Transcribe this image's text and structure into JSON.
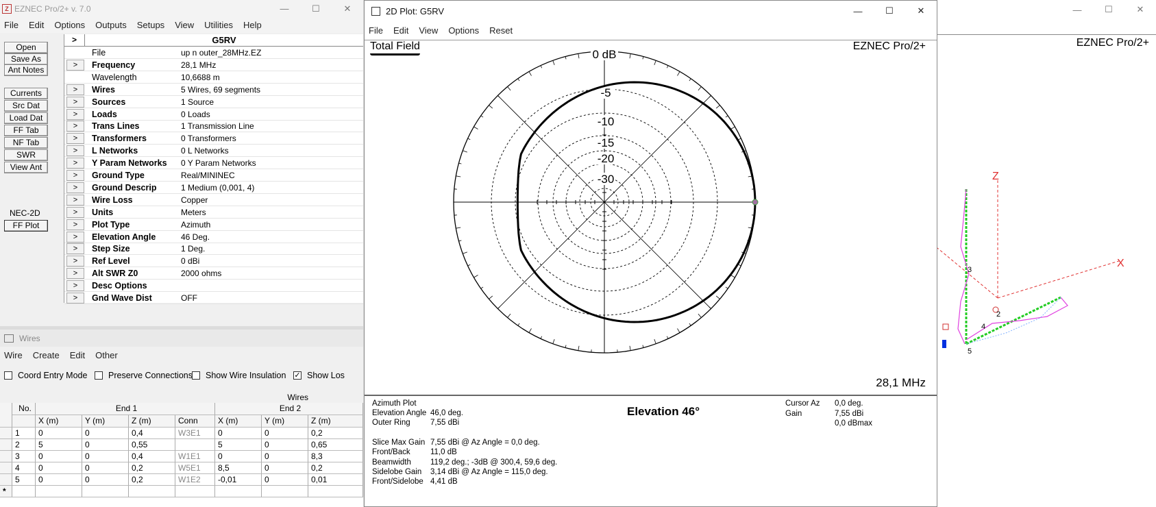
{
  "main": {
    "title": "EZNEC Pro/2+  v. 7.0",
    "menu": [
      "File",
      "Edit",
      "Options",
      "Outputs",
      "Setups",
      "View",
      "Utilities",
      "Help"
    ],
    "buttons_top": [
      "Open",
      "Save As",
      "Ant Notes"
    ],
    "buttons_mid": [
      "Currents",
      "Src Dat",
      "Load Dat",
      "FF Tab",
      "NF Tab",
      "SWR",
      "View Ant"
    ],
    "engine": "NEC-2D",
    "ffplot": "FF Plot",
    "model_name": "G5RV",
    "header_arrow": ">",
    "rows": [
      {
        "label": "File",
        "value": "up n outer_28MHz.EZ",
        "arrow": false,
        "bold": false
      },
      {
        "label": "Frequency",
        "value": "28,1 MHz",
        "arrow": true,
        "bold": true
      },
      {
        "label": "Wavelength",
        "value": "10,6688 m",
        "arrow": false,
        "bold": false
      },
      {
        "label": "Wires",
        "value": "5 Wires, 69 segments",
        "arrow": true,
        "bold": true
      },
      {
        "label": "Sources",
        "value": "1 Source",
        "arrow": true,
        "bold": true
      },
      {
        "label": "Loads",
        "value": "0 Loads",
        "arrow": true,
        "bold": true
      },
      {
        "label": "Trans Lines",
        "value": "1 Transmission Line",
        "arrow": true,
        "bold": true
      },
      {
        "label": "Transformers",
        "value": "0 Transformers",
        "arrow": true,
        "bold": true
      },
      {
        "label": "L Networks",
        "value": "0 L Networks",
        "arrow": true,
        "bold": true
      },
      {
        "label": "Y Param Networks",
        "value": "0 Y Param Networks",
        "arrow": true,
        "bold": true
      },
      {
        "label": "Ground Type",
        "value": "Real/MININEC",
        "arrow": true,
        "bold": true
      },
      {
        "label": "Ground Descrip",
        "value": "1 Medium (0,001, 4)",
        "arrow": true,
        "bold": true
      },
      {
        "label": "Wire Loss",
        "value": "Copper",
        "arrow": true,
        "bold": true
      },
      {
        "label": "Units",
        "value": "Meters",
        "arrow": true,
        "bold": true
      },
      {
        "label": "Plot Type",
        "value": "Azimuth",
        "arrow": true,
        "bold": true
      },
      {
        "label": "Elevation Angle",
        "value": "46 Deg.",
        "arrow": true,
        "bold": true
      },
      {
        "label": "Step Size",
        "value": "1 Deg.",
        "arrow": true,
        "bold": true
      },
      {
        "label": "Ref Level",
        "value": "0 dBi",
        "arrow": true,
        "bold": true
      },
      {
        "label": "Alt SWR Z0",
        "value": "2000 ohms",
        "arrow": true,
        "bold": true
      },
      {
        "label": "Desc Options",
        "value": "",
        "arrow": true,
        "bold": true
      },
      {
        "label": "Gnd Wave Dist",
        "value": "OFF",
        "arrow": true,
        "bold": true
      }
    ],
    "arrow_glyph": ">"
  },
  "wires": {
    "title": "Wires",
    "menu": [
      "Wire",
      "Create",
      "Edit",
      "Other"
    ],
    "checks": [
      {
        "label": "Coord Entry Mode",
        "checked": false
      },
      {
        "label": "Preserve Connections",
        "checked": false
      },
      {
        "label": "Show Wire Insulation",
        "checked": false
      },
      {
        "label": "Show Los",
        "checked": true
      }
    ],
    "table_caption": "Wires",
    "group_headers": [
      "End 1",
      "End 2"
    ],
    "columns": [
      "No.",
      "X (m)",
      "Y (m)",
      "Z (m)",
      "Conn",
      "X (m)",
      "Y (m)",
      "Z (m)"
    ],
    "rows": [
      [
        "1",
        "0",
        "0",
        "0,4",
        "W3E1",
        "0",
        "0",
        "0,2"
      ],
      [
        "2",
        "5",
        "0",
        "0,55",
        "",
        "5",
        "0",
        "0,65"
      ],
      [
        "3",
        "0",
        "0",
        "0,4",
        "W1E1",
        "0",
        "0",
        "8,3"
      ],
      [
        "4",
        "0",
        "0",
        "0,2",
        "W5E1",
        "8,5",
        "0",
        "0,2"
      ],
      [
        "5",
        "0",
        "0",
        "0,2",
        "W1E2",
        "-0,01",
        "0",
        "0,01"
      ]
    ],
    "new_row_marker": "*"
  },
  "plot": {
    "title": "2D Plot: G5RV",
    "menu": [
      "File",
      "Edit",
      "View",
      "Options",
      "Reset"
    ],
    "field_label": "Total Field",
    "brand": "EZNEC Pro/2+",
    "frequency": "28,1 MHz",
    "ring_labels": [
      "0 dB",
      "-5",
      "-10",
      "-15",
      "-20",
      "-30"
    ],
    "main_heading": "Elevation 46°",
    "info_left": [
      {
        "k": "Azimuth Plot",
        "v": ""
      },
      {
        "k": "Elevation Angle",
        "v": "46,0 deg."
      },
      {
        "k": "Outer Ring",
        "v": "7,55 dBi"
      },
      {
        "k": "",
        "v": ""
      },
      {
        "k": "Slice Max Gain",
        "v": "7,55 dBi @ Az Angle = 0,0 deg."
      },
      {
        "k": "Front/Back",
        "v": "11,0 dB"
      },
      {
        "k": "Beamwidth",
        "v": "119,2 deg.; -3dB @ 300,4, 59,6 deg."
      },
      {
        "k": "Sidelobe Gain",
        "v": "3,14 dBi @ Az Angle = 115,0 deg."
      },
      {
        "k": "Front/Sidelobe",
        "v": "4,41 dB"
      }
    ],
    "info_right": [
      {
        "k": "Cursor Az",
        "v": "0,0 deg."
      },
      {
        "k": "Gain",
        "v": "7,55 dBi"
      },
      {
        "k": "",
        "v": "0,0 dBmax"
      }
    ]
  },
  "ant3d": {
    "brand": "EZNEC Pro/2+",
    "axis_z": "Z",
    "axis_x": "X",
    "wire_labels": [
      "3",
      "4",
      "2",
      "5"
    ]
  },
  "caption_buttons": {
    "min": "—",
    "max": "☐",
    "close": "✕"
  },
  "colors": {
    "wire_green": "#22cc22",
    "current_magenta": "#e040e0",
    "axis_red": "#e03030",
    "pattern": "#000000"
  }
}
